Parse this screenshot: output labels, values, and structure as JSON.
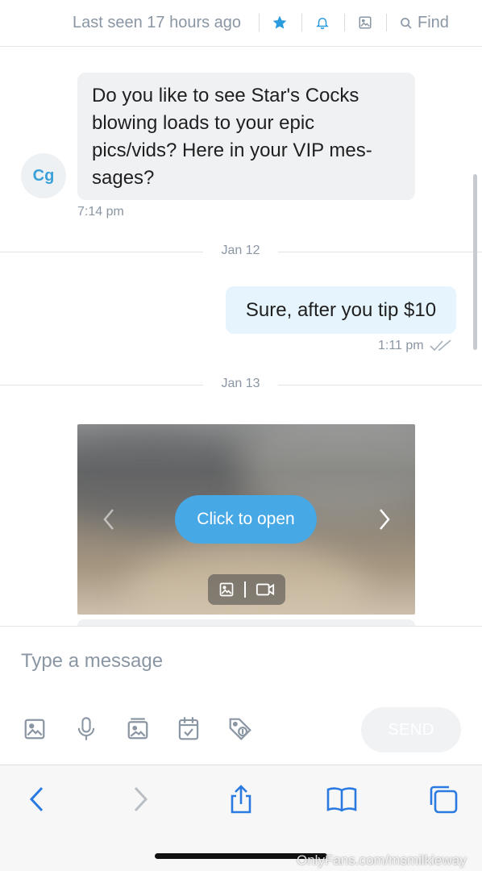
{
  "header": {
    "last_seen": "Last seen 17 hours ago",
    "find_label": "Find",
    "icons": [
      "star-icon",
      "bell-icon",
      "image-icon",
      "search-icon"
    ],
    "accent_color": "#00aff0"
  },
  "chat": {
    "avatar_initials": "Cg",
    "messages": [
      {
        "direction": "incoming",
        "text": "Do you like to see Star's Cocks blowing loads to your epic pics/vids? Here in your VIP mes- sages?",
        "time": "7:14 pm"
      },
      {
        "direction": "outgoing",
        "text": "Sure, after you tip $10",
        "time": "1:11 pm",
        "status": "read"
      }
    ],
    "date_separators": [
      "Jan 12",
      "Jan 13"
    ],
    "media": {
      "button_label": "Click to open",
      "media_types": [
        "photo-icon",
        "video-icon"
      ]
    }
  },
  "composer": {
    "placeholder": "Type a message",
    "value": "",
    "tools": [
      "image-icon",
      "microphone-icon",
      "vault-icon",
      "calendar-icon",
      "price-tag-icon"
    ],
    "send_label": "SEND"
  },
  "browser": {
    "icons": [
      "back-icon",
      "forward-icon",
      "share-icon",
      "bookmarks-icon",
      "tabs-icon"
    ],
    "color": "#2a7ae2"
  },
  "watermark": "OnlyFans.com/msmilkieway"
}
